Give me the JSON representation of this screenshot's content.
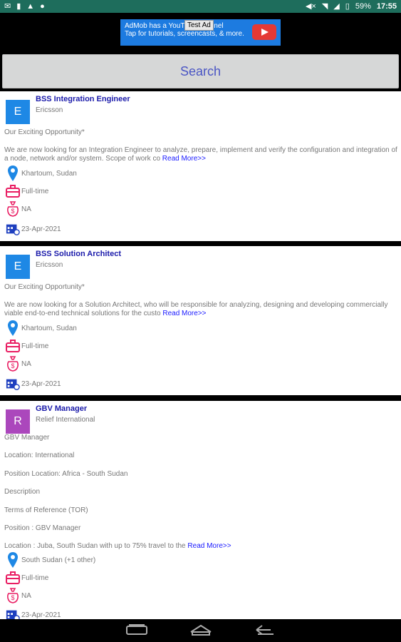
{
  "status": {
    "battery": "59%",
    "time": "17:55"
  },
  "ad": {
    "line1": "AdMob has a YouTube channel",
    "line2": "Tap for tutorials, screencasts, & more.",
    "tag": "Test Ad"
  },
  "search": {
    "label": "Search"
  },
  "jobs": [
    {
      "avatar_letter": "E",
      "avatar_color": "#1e88e5",
      "title": "BSS Integration Engineer",
      "company": "Ericsson",
      "intro": "Our Exciting Opportunity*",
      "desc": "We are now looking for an Integration Engineer to analyze, prepare, implement and verify the configuration and integration of a node, network and/or system. Scope of work co",
      "read_more": "Read More>>",
      "location": "Khartoum, Sudan",
      "type": "Full-time",
      "salary": "NA",
      "date": "23-Apr-2021"
    },
    {
      "avatar_letter": "E",
      "avatar_color": "#1e88e5",
      "title": "BSS Solution Architect",
      "company": "Ericsson",
      "intro": "Our Exciting Opportunity*",
      "desc": "We are now looking for a Solution Architect, who will be responsible for analyzing, designing and developing commercially viable end-to-end technical solutions for the custo",
      "read_more": "Read More>>",
      "location": "Khartoum, Sudan",
      "type": "Full-time",
      "salary": "NA",
      "date": "23-Apr-2021"
    },
    {
      "avatar_letter": "R",
      "avatar_color": "#ab47bc",
      "title": "GBV Manager",
      "company": "Relief International",
      "lines": [
        "GBV Manager",
        "Location: International",
        "Position Location: Africa - South Sudan",
        "Description",
        "Terms of Reference (TOR)",
        "Position : GBV Manager"
      ],
      "desc": "Location : Juba, South Sudan with up to 75% travel to the",
      "read_more": "Read More>>",
      "location": "South Sudan (+1 other)",
      "type": "Full-time",
      "salary": "NA",
      "date": "23-Apr-2021"
    }
  ]
}
